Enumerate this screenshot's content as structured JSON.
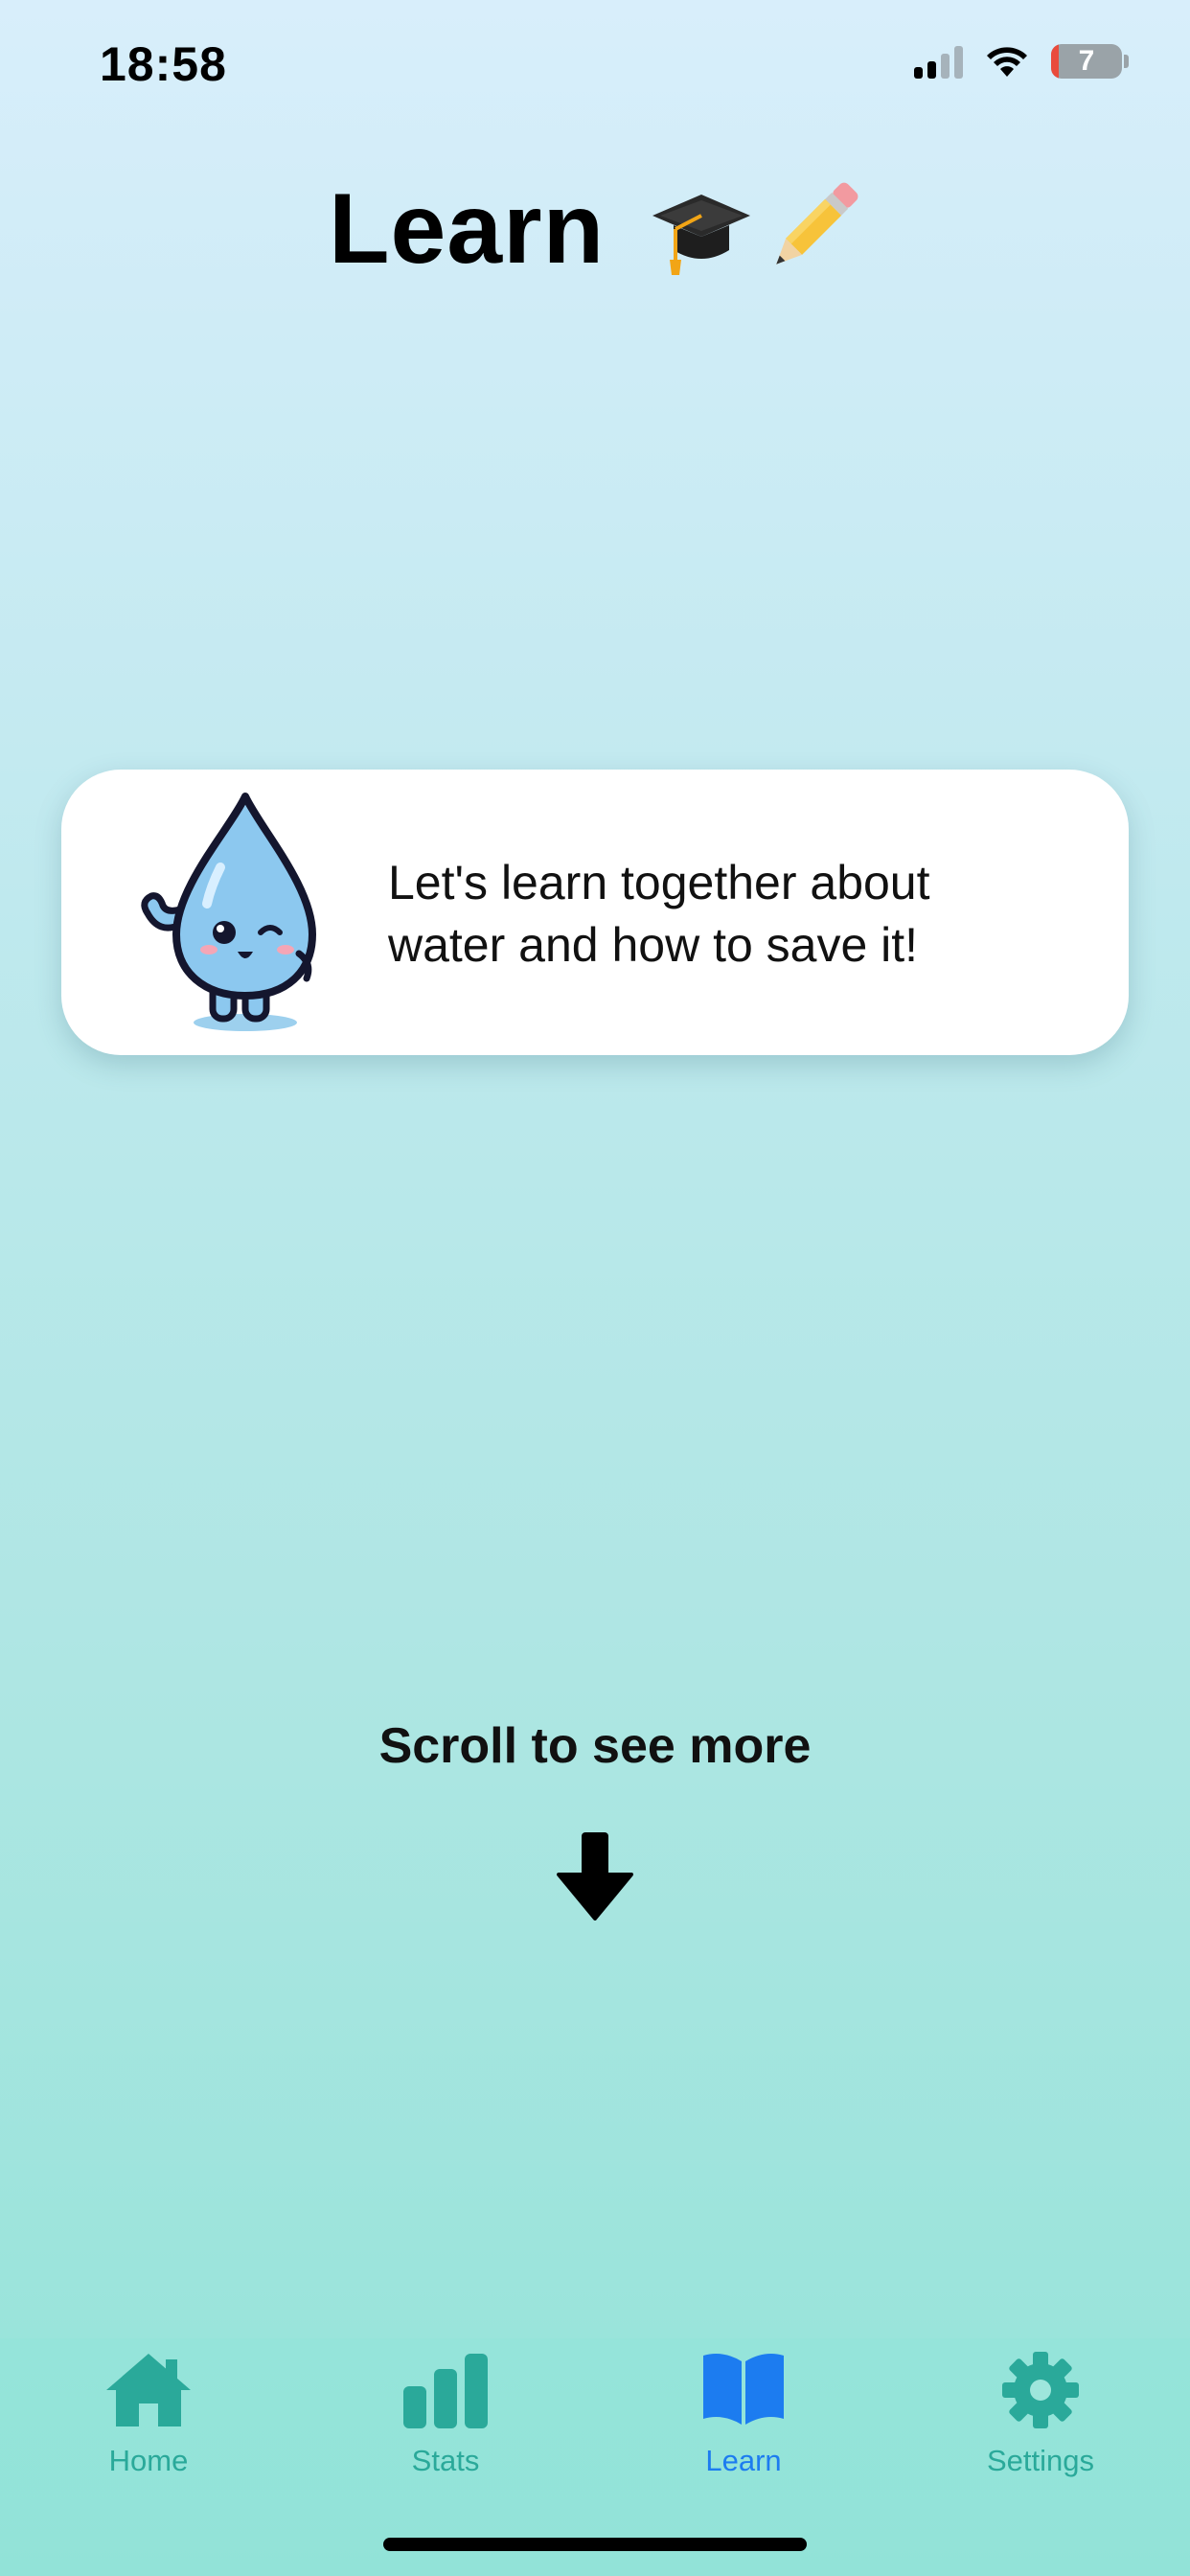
{
  "status_bar": {
    "time": "18:58",
    "battery_level": "7"
  },
  "header": {
    "title": "Learn"
  },
  "intro_card": {
    "message": "Let's learn together about water and how to save it!"
  },
  "scroll_hint": {
    "label": "Scroll to see more"
  },
  "tab_bar": {
    "tabs": [
      {
        "label": "Home",
        "icon": "house-icon"
      },
      {
        "label": "Stats",
        "icon": "bar-chart-icon"
      },
      {
        "label": "Learn",
        "icon": "book-icon",
        "active": true
      },
      {
        "label": "Settings",
        "icon": "gear-icon"
      }
    ]
  },
  "colors": {
    "tab_inactive": "#2aa99a",
    "tab_active": "#1c7cf0",
    "mascot_blue": "#8cc8ef"
  }
}
